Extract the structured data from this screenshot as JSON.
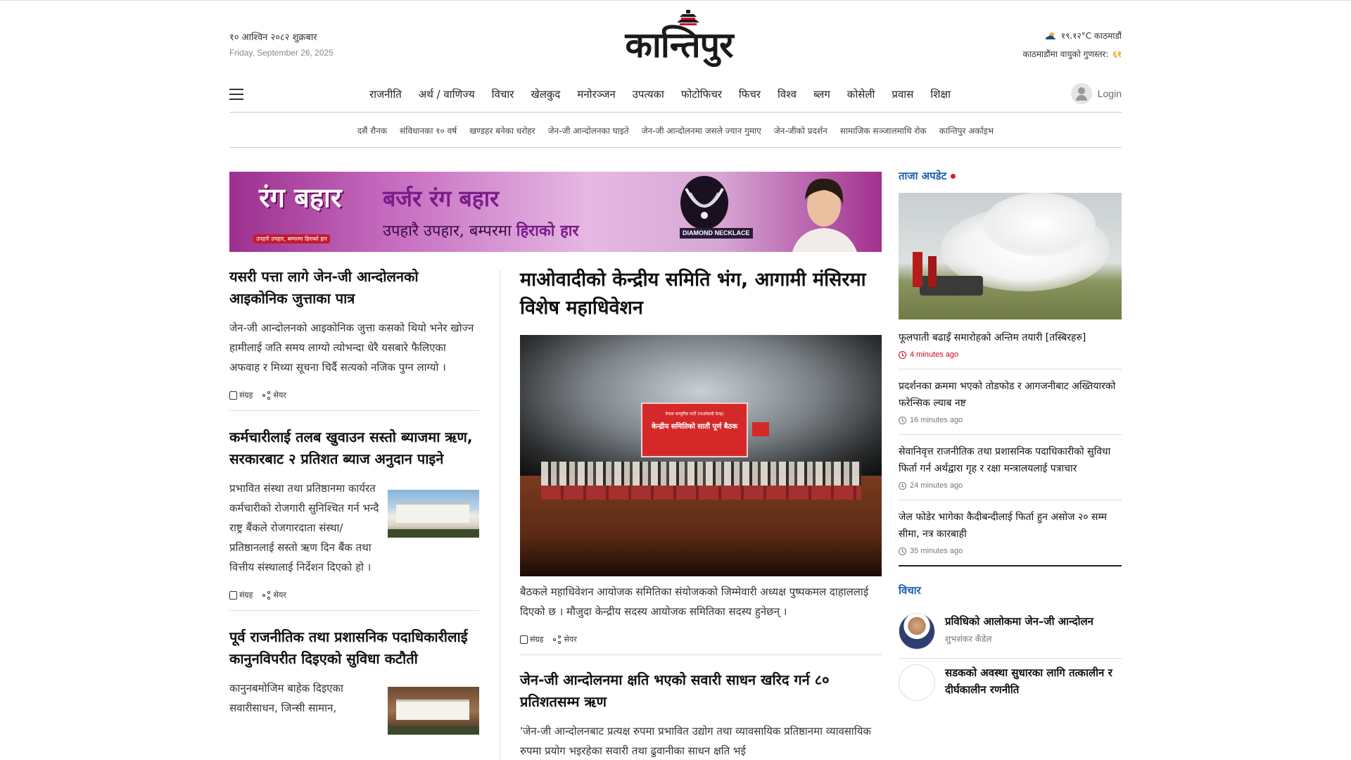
{
  "header": {
    "date_np": "१० आश्विन २०८२ शुक्रबार",
    "date_en": "Friday, September 26, 2025",
    "logo_text": "कान्तिपुर",
    "weather": "१९.१२°C काठमाडौं",
    "aq_label": "काठमाडौंमा वायुको गुणस्तर:",
    "aq_value": "६१",
    "login": "Login"
  },
  "nav": {
    "items": [
      "राजनीति",
      "अर्थ / वाणिज्य",
      "विचार",
      "खेलकुद",
      "मनोरञ्जन",
      "उपत्यका",
      "फोटोफिचर",
      "फिचर",
      "विश्व",
      "ब्लग",
      "कोसेली",
      "प्रवास",
      "शिक्षा"
    ]
  },
  "subnav": {
    "items": [
      "दसैं रौनक",
      "संविधानका १० वर्ष",
      "खण्डहर बनेका धरोहर",
      "जेन-जी आन्दोलनका घाइते",
      "जेन-जी आन्दोलनमा जसले ज्यान गुमाए",
      "जेन-जीको प्रदर्शन",
      "सामाजिक सञ्जालमाथि रोक",
      "कान्तिपुर अर्काइभ"
    ]
  },
  "ad": {
    "logo_text": "रंग बहार",
    "logo_sub": "उपहारै उपहार, बम्परमा हिराको हार",
    "title": "बर्जर रंग बहार",
    "sub_prefix": "उपहारै उपहार, बम्परमा ",
    "sub_bold": "हिराको हार",
    "necklace_badge": "DIAMOND NECKLACE"
  },
  "left": {
    "stories": [
      {
        "title": "यसरी पत्ता लागे जेन-जी आन्दोलनको आइकोनिक जुत्ताका पात्र",
        "summary": "जेन-जी आन्दोलनको आइकोनिक जुत्ता कसको थियो भनेर खोज्न हामीलाई जति समय लाग्यो त्योभन्दा धेरै यसबारे फैलिएका अफवाह र मिथ्या सूचना चिर्दै सत्यको नजिक पुग्न लाग्यो ।"
      },
      {
        "title": "कर्मचारीलाई तलब खुवाउन सस्तो ब्याजमा ऋण, सरकारबाट २ प्रतिशत ब्याज अनुदान पाइने",
        "summary": "प्रभावित संस्था तथा प्रतिष्ठानमा कार्यरत कर्मचारीको रोजगारी सुनिश्चित गर्न भन्दै राष्ट्र बैंकले रोजगारदाता संस्था/प्रतिष्ठानलाई सस्तो ऋण दिन बैंक तथा वित्तीय संस्थालाई निर्देशन दिएको हो ।"
      },
      {
        "title": "पूर्व राजनीतिक तथा प्रशासनिक पदाधिकारीलाई कानुनविपरीत दिइएको सुविधा कटौती",
        "summary": "कानुनबमोजिम बाहेक दिइएका सवारीसाधन, जिन्सी सामान,"
      }
    ],
    "save_label": "संग्रह",
    "share_label": "सेयर"
  },
  "center": {
    "lead_title": "माओवादीको केन्द्रीय समिति भंग, आगामी मंसिरमा विशेष महाधिवेशन",
    "lead_summary": "बैठकले महाधिवेशन आयोजक समितिका संयोजकको जिम्मेवारी अध्यक्ष पुष्पकमल दाहाललाई दिएको छ । मौजुदा केन्द्रीय सदस्य आयोजक समितिका सदस्य हुनेछन् ।",
    "banner_line1": "नेपाल कम्युनिष्ट पार्टी (माओवादी केन्द्र)",
    "banner_line2": "केन्द्रीय समितिको सातौं पूर्ण बैठक",
    "story2_title": "जेन-जी आन्दोलनमा क्षति भएको सवारी साधन खरिद गर्न ८० प्रतिशतसम्म ऋण",
    "story2_summary": "'जेन-जी आन्दोलनबाट प्रत्यक्ष रुपमा प्रभावित उद्योग तथा व्यावसायिक प्रतिष्ठानमा व्यावसायिक रुपमा प्रयोग भइरहेका सवारी तथा ढुवानीका साधन क्षति भई"
  },
  "right": {
    "latest_head": "ताजा अपडेट",
    "latest": [
      {
        "title": "फूलपाती बढाइँ समारोहको अन्तिम तयारी [तस्बिरहरु]",
        "time": "4 minutes ago"
      },
      {
        "title": "प्रदर्शनका क्रममा भएको तोडफोड र आगजनीबाट अख्तियारको फरेन्सिक ल्याब नष्ट",
        "time": "16 minutes ago"
      },
      {
        "title": "सेवानिवृत्त राजनीतिक तथा प्रशासनिक पदाधिकारीको सुविधा फिर्ता गर्न अर्थद्वारा गृह र रक्षा मन्त्रालयलाई पत्राचार",
        "time": "24 minutes ago"
      },
      {
        "title": "जेल फोडेर भागेका कैदीबन्दीलाई फिर्ता हुन असोज २० सम्म सीमा, नत्र कारबाही",
        "time": "35 minutes ago"
      }
    ],
    "opinion_head": "विचार",
    "opinions": [
      {
        "title": "प्रविधिको आलोकमा जेन–जी आन्दोलन",
        "author": "शुभशंकर कँडेल"
      },
      {
        "title": "सडकको अवस्था सुधारका लागि तत्कालीन र दीर्घकालीन रणनीति",
        "author": ""
      }
    ]
  },
  "colors": {
    "accent": "#1a5faa",
    "live": "#e01b24",
    "aq": "#e8a317"
  }
}
